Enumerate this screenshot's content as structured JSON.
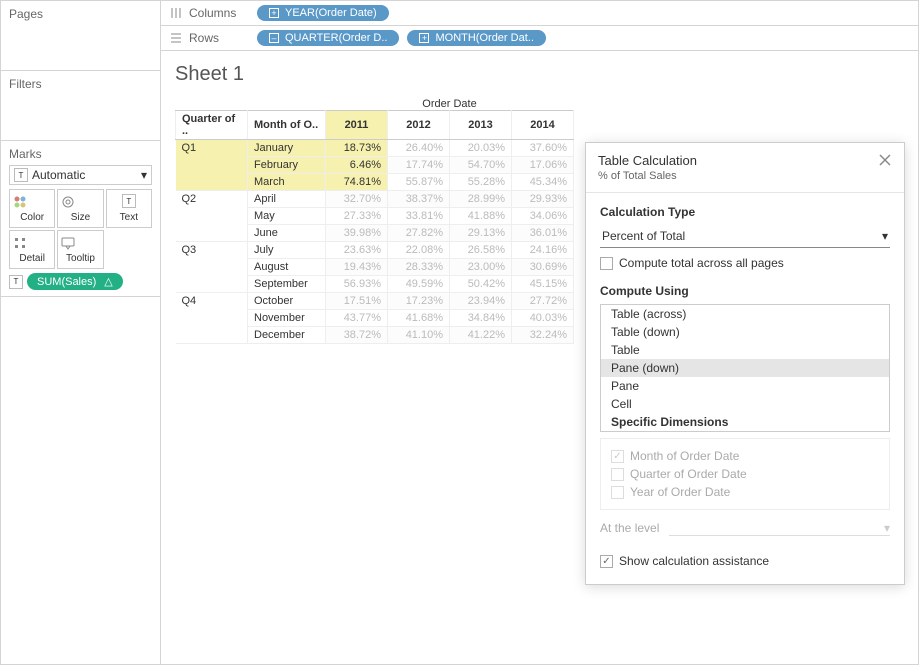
{
  "sidebar": {
    "pages_title": "Pages",
    "filters_title": "Filters",
    "marks_title": "Marks",
    "automatic_label": "Automatic",
    "mark_buttons": [
      "Color",
      "Size",
      "Text",
      "Detail",
      "Tooltip"
    ],
    "measure_pill": "SUM(Sales)"
  },
  "shelves": {
    "columns_label": "Columns",
    "rows_label": "Rows",
    "column_pills": [
      "YEAR(Order Date)"
    ],
    "row_pills": [
      "QUARTER(Order D..",
      "MONTH(Order Dat.."
    ]
  },
  "sheet": {
    "title": "Sheet 1",
    "super_header": "Order Date",
    "row_header1": "Quarter of ..",
    "row_header2": "Month of O..",
    "years": [
      "2011",
      "2012",
      "2013",
      "2014"
    ],
    "highlight_year_index": 0,
    "quarters": [
      "Q1",
      "Q2",
      "Q3",
      "Q4"
    ],
    "months": [
      "January",
      "February",
      "March",
      "April",
      "May",
      "June",
      "July",
      "August",
      "September",
      "October",
      "November",
      "December"
    ],
    "values": [
      [
        "18.73%",
        "26.40%",
        "20.03%",
        "37.60%"
      ],
      [
        "6.46%",
        "17.74%",
        "54.70%",
        "17.06%"
      ],
      [
        "74.81%",
        "55.87%",
        "55.28%",
        "45.34%"
      ],
      [
        "32.70%",
        "38.37%",
        "28.99%",
        "29.93%"
      ],
      [
        "27.33%",
        "33.81%",
        "41.88%",
        "34.06%"
      ],
      [
        "39.98%",
        "27.82%",
        "29.13%",
        "36.01%"
      ],
      [
        "23.63%",
        "22.08%",
        "26.58%",
        "24.16%"
      ],
      [
        "19.43%",
        "28.33%",
        "23.00%",
        "30.69%"
      ],
      [
        "56.93%",
        "49.59%",
        "50.42%",
        "45.15%"
      ],
      [
        "17.51%",
        "17.23%",
        "23.94%",
        "27.72%"
      ],
      [
        "43.77%",
        "41.68%",
        "34.84%",
        "40.03%"
      ],
      [
        "38.72%",
        "41.10%",
        "41.22%",
        "32.24%"
      ]
    ]
  },
  "dialog": {
    "title": "Table Calculation",
    "subtitle": "% of Total Sales",
    "calc_type_label": "Calculation Type",
    "calc_type_value": "Percent of Total",
    "compute_total_label": "Compute total across all pages",
    "compute_using_label": "Compute Using",
    "options": [
      "Table (across)",
      "Table (down)",
      "Table",
      "Pane (down)",
      "Pane",
      "Cell",
      "Specific Dimensions"
    ],
    "selected_option": "Pane (down)",
    "specific_dims": [
      {
        "label": "Month of Order Date",
        "checked": true
      },
      {
        "label": "Quarter of Order Date",
        "checked": false
      },
      {
        "label": "Year of Order Date",
        "checked": false
      }
    ],
    "at_level_label": "At the level",
    "show_assist_label": "Show calculation assistance",
    "show_assist_checked": true
  }
}
